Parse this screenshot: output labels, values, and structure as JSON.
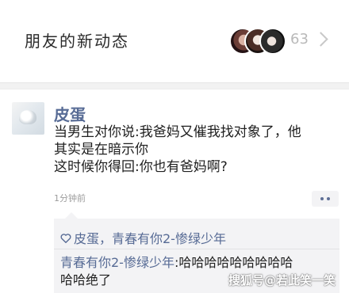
{
  "moments_bar": {
    "title": "朋友的新动态",
    "count": "63",
    "avatars": [
      "friend-avatar-1",
      "friend-avatar-2",
      "friend-avatar-3"
    ]
  },
  "post": {
    "author": "皮蛋",
    "content_lines": [
      "当男生对你说:我爸妈又催我找对象了，他",
      "其实是在暗示你",
      "这时候你得回:你也有爸妈啊?"
    ],
    "time": "1分钟前",
    "likes": "皮蛋，青春有你2-惨绿少年",
    "comment": {
      "commenter": "青春有你2-惨绿少年",
      "separator": ":",
      "text_line1": "哈哈哈哈哈哈哈哈哈",
      "text_line2": "哈哈绝了"
    }
  },
  "watermark": "搜狐号@若此笑一笑",
  "colors": {
    "link_blue": "#576b95",
    "feedback_bg": "#f3f3f5",
    "divider_bg": "#f2f2f2"
  }
}
